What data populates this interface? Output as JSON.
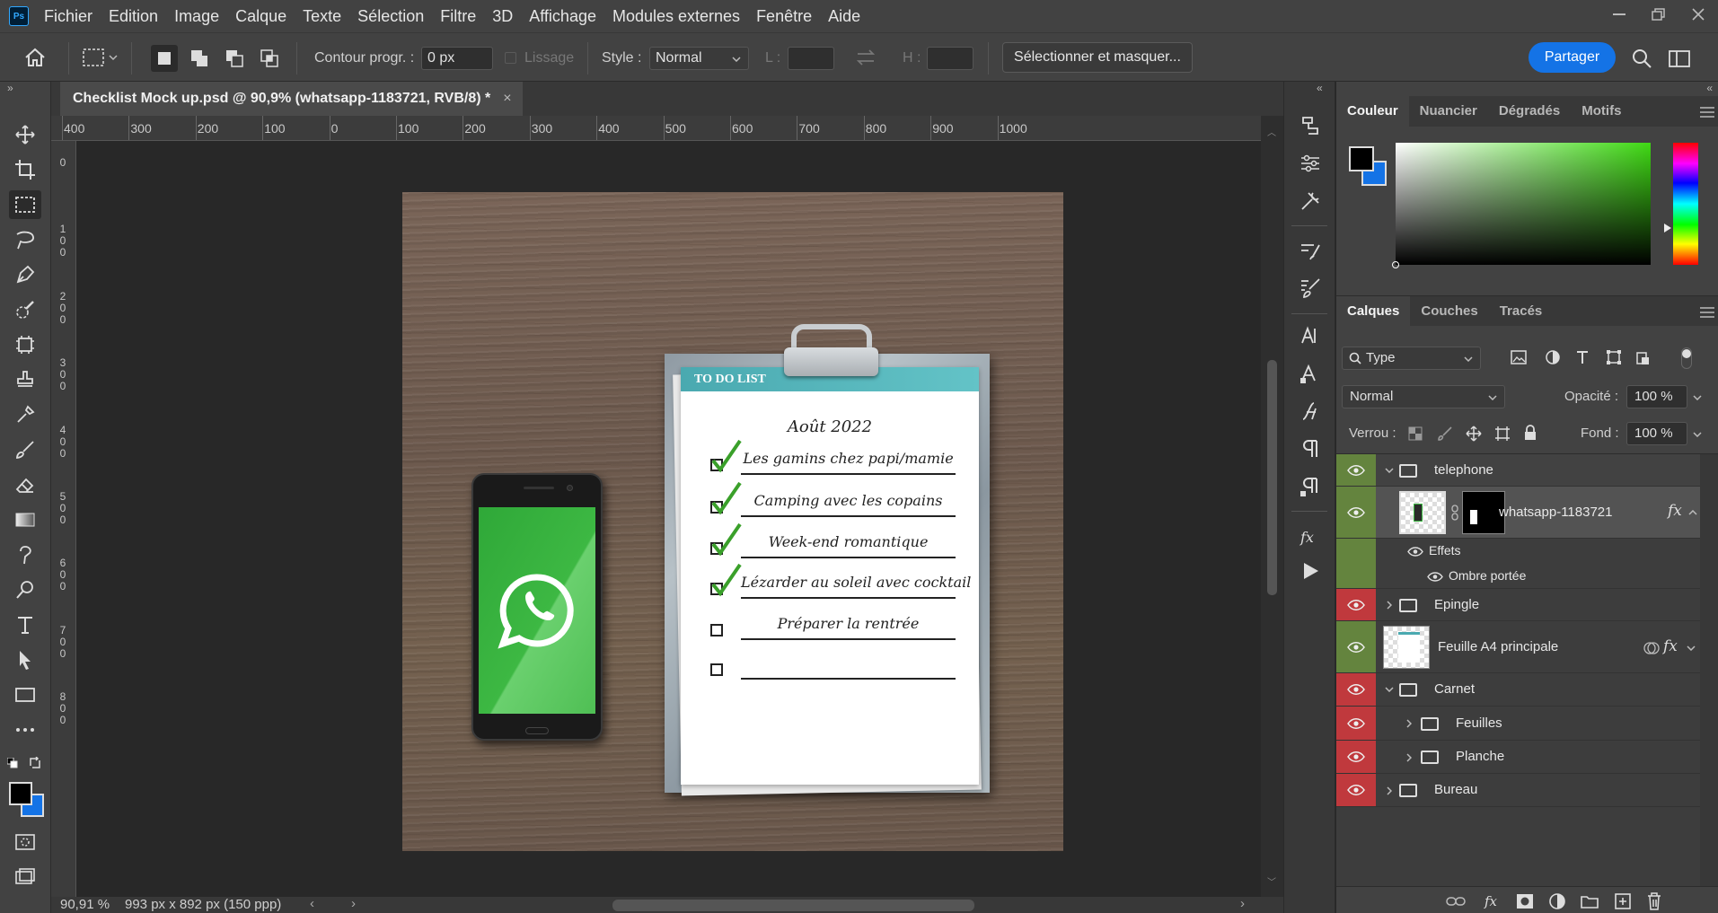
{
  "app": {
    "logo": "Ps"
  },
  "menu": [
    "Fichier",
    "Edition",
    "Image",
    "Calque",
    "Texte",
    "Sélection",
    "Filtre",
    "3D",
    "Affichage",
    "Modules externes",
    "Fenêtre",
    "Aide"
  ],
  "options": {
    "feather_label": "Contour progr. :",
    "feather_value": "0 px",
    "smoothing_label": "Lissage",
    "style_label": "Style :",
    "style_value": "Normal",
    "width_label": "L :",
    "height_label": "H :",
    "select_mask_label": "Sélectionner et masquer...",
    "share_label": "Partager"
  },
  "document": {
    "tab_title": "Checklist Mock up.psd @ 90,9% (whatsapp-1183721, RVB/8) *",
    "close": "×"
  },
  "rulers": {
    "horizontal": [
      "400",
      "300",
      "200",
      "100",
      "0",
      "100",
      "200",
      "300",
      "400",
      "500",
      "600",
      "700",
      "800",
      "900",
      "1000"
    ],
    "vertical": [
      "0",
      "100",
      "200",
      "300",
      "400",
      "500",
      "600",
      "700",
      "800"
    ]
  },
  "artwork": {
    "todo_title": "TO DO LIST",
    "date": "Août 2022",
    "items": [
      {
        "text": "Les gamins chez papi/mamie",
        "checked": true
      },
      {
        "text": "Camping avec les copains",
        "checked": true
      },
      {
        "text": "Week-end romantique",
        "checked": true
      },
      {
        "text": "Lézarder au soleil avec cocktail",
        "checked": true
      },
      {
        "text": "Préparer la rentrée",
        "checked": false
      },
      {
        "text": "",
        "checked": false
      }
    ]
  },
  "status": {
    "zoom": "90,91 %",
    "size": "993 px x 892 px (150 ppp)"
  },
  "color_panel": {
    "tabs": [
      "Couleur",
      "Nuancier",
      "Dégradés",
      "Motifs"
    ],
    "foreground": "#000000",
    "background": "#1473e6"
  },
  "layers_panel": {
    "tabs": [
      "Calques",
      "Couches",
      "Tracés"
    ],
    "filter_value": "Type",
    "blend_mode": "Normal",
    "opacity_label": "Opacité :",
    "opacity_value": "100 %",
    "lock_label": "Verrou :",
    "fill_label": "Fond :",
    "fill_value": "100 %",
    "layers": [
      {
        "name": "telephone",
        "kind": "group",
        "expanded": true,
        "color": "green"
      },
      {
        "name": "whatsapp-1183721",
        "kind": "layer",
        "fx": "fx",
        "color": "green"
      },
      {
        "name": "Effets",
        "kind": "effects"
      },
      {
        "name": "Ombre portée",
        "kind": "effect"
      },
      {
        "name": "Epingle",
        "kind": "group",
        "expanded": false,
        "color": "red"
      },
      {
        "name": "Feuille A4 principale",
        "kind": "smart",
        "fx": "fx",
        "color": "green"
      },
      {
        "name": "Carnet",
        "kind": "group",
        "expanded": true,
        "color": "red"
      },
      {
        "name": "Feuilles",
        "kind": "group",
        "expanded": false,
        "color": "red"
      },
      {
        "name": "Planche",
        "kind": "group",
        "expanded": false,
        "color": "red"
      },
      {
        "name": "Bureau",
        "kind": "group",
        "expanded": false,
        "color": "red"
      }
    ]
  }
}
